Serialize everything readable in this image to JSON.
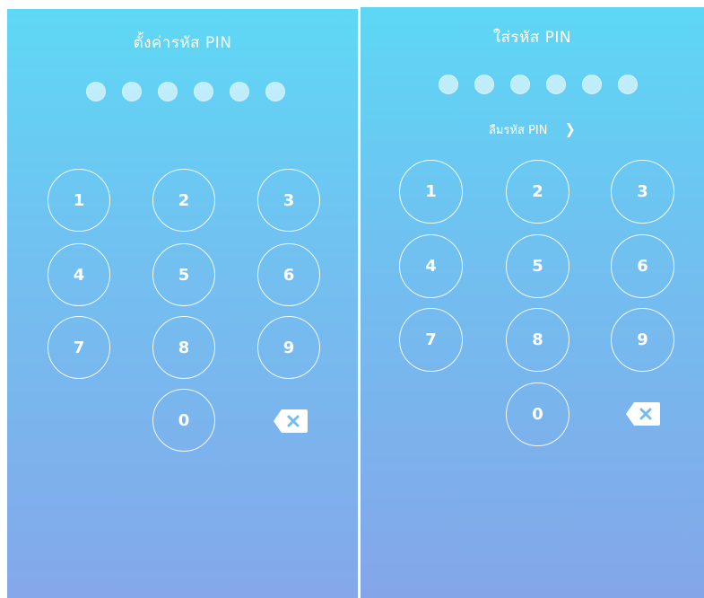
{
  "screens": [
    {
      "title": "ตั้งค่ารหัส PIN",
      "forgot_label": "",
      "pin_dots": 6,
      "keys": [
        "1",
        "2",
        "3",
        "4",
        "5",
        "6",
        "7",
        "8",
        "9",
        "0"
      ]
    },
    {
      "title": "ใส่รหัส PIN",
      "forgot_label": "ลืมรหัส PIN",
      "pin_dots": 6,
      "keys": [
        "1",
        "2",
        "3",
        "4",
        "5",
        "6",
        "7",
        "8",
        "9",
        "0"
      ]
    }
  ],
  "icons": {
    "forgot_chevron": "chevron-right-icon",
    "delete": "backspace-icon"
  },
  "colors": {
    "gradient_top": "#5ed8f5",
    "gradient_bottom": "#84a8ea",
    "foreground": "#ffffff"
  }
}
